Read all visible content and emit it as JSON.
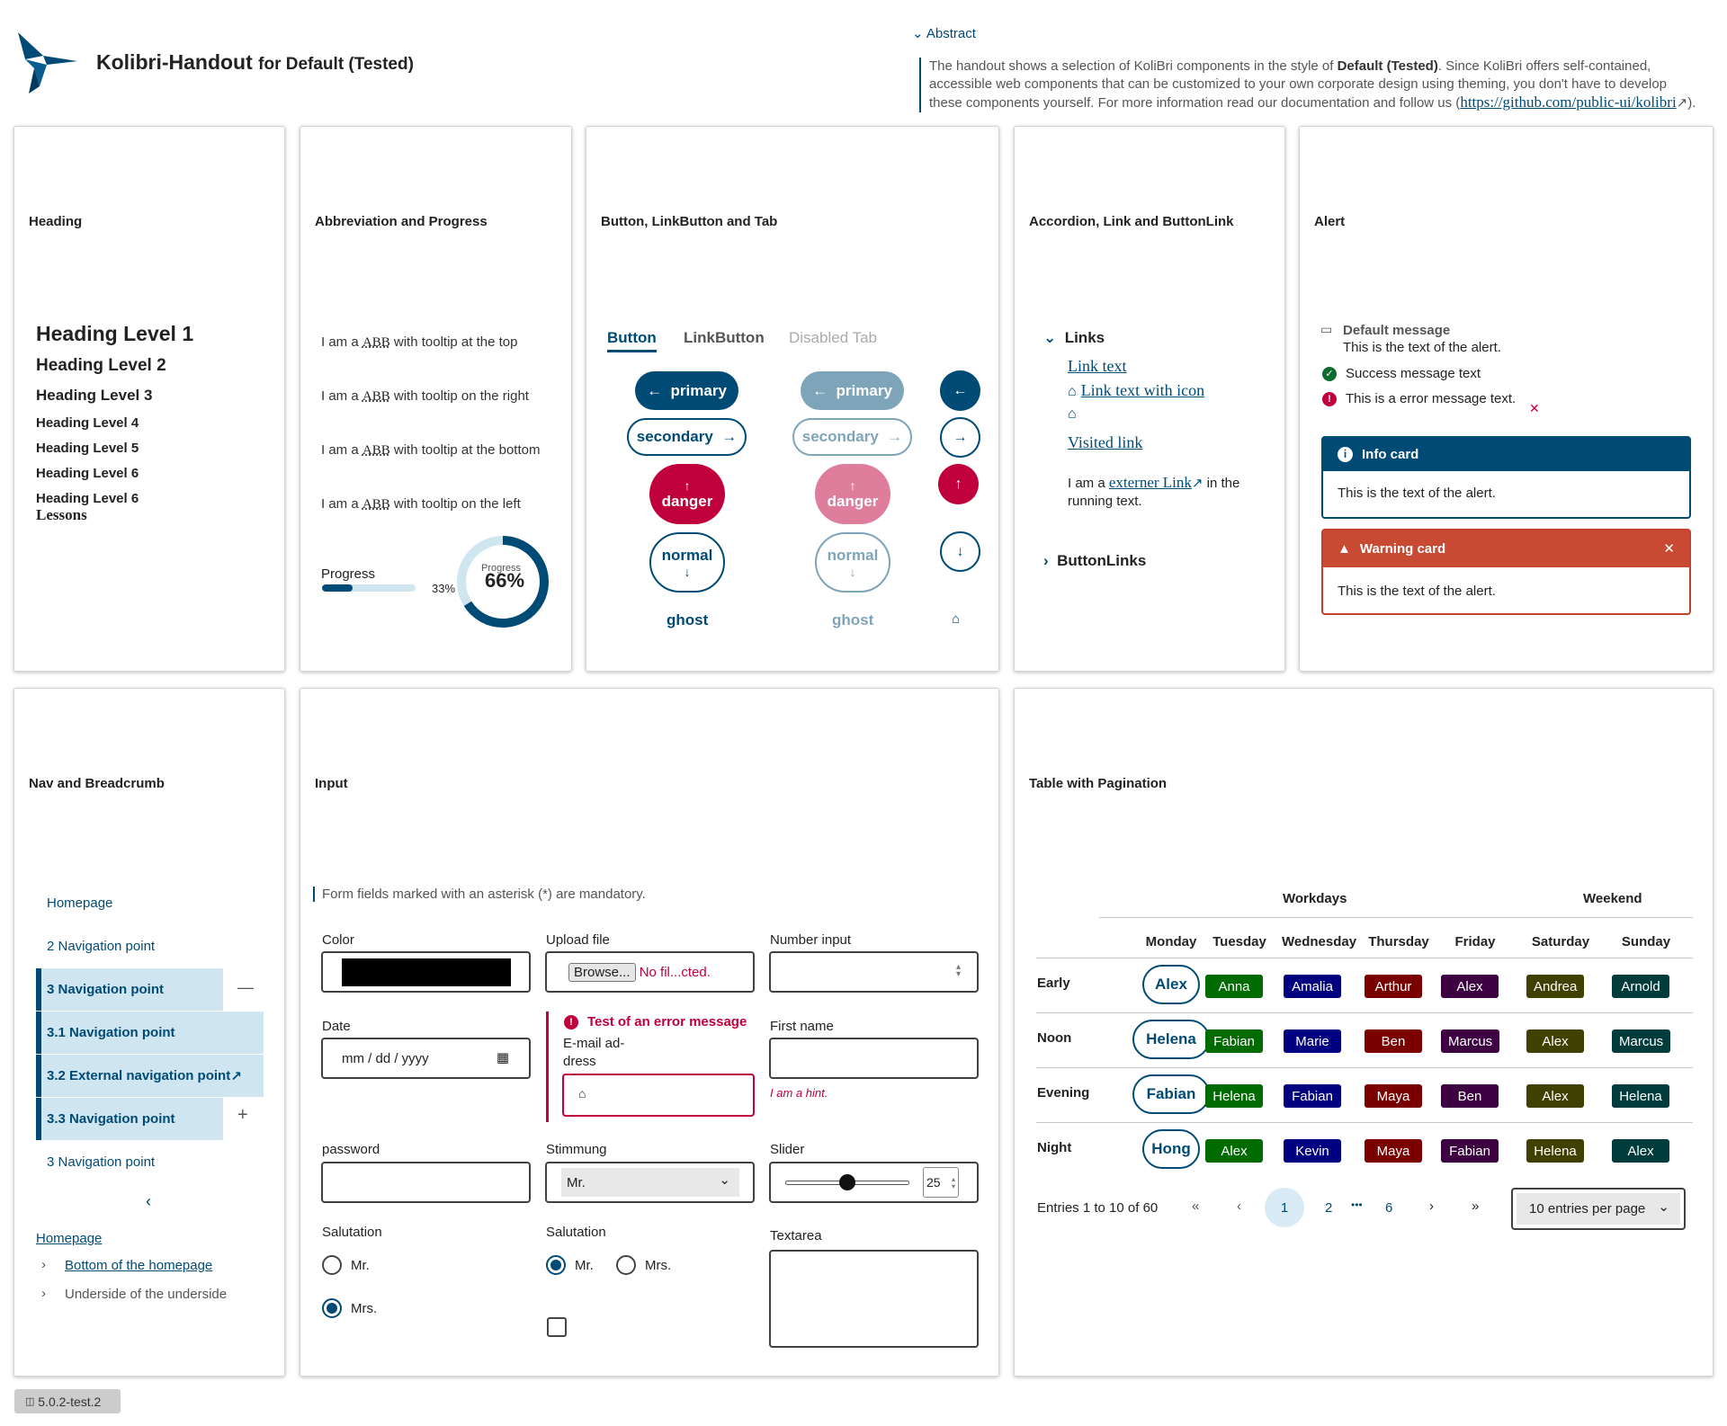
{
  "header": {
    "app_title": "Kolibri-Handout",
    "app_subtitle": "for Default (Tested)",
    "abstract_toggle": "Abstract",
    "abstract_pre": "The handout shows a selection of KoliBri components in the style of ",
    "abstract_bold": "Default (Tested)",
    "abstract_post": ". Since KoliBri offers self-contained, accessible web components that can be customized to your own corporate design using theming, you don't have to develop these components yourself. For more information read our documentation and follow us (",
    "abstract_link": "https://github.com/public-ui/kolibri",
    "abstract_end": ")."
  },
  "cards": {
    "heading": "Heading",
    "abbr": "Abbreviation and Progress",
    "button": "Button, LinkButton and Tab",
    "accordion": "Accordion, Link and ButtonLink",
    "alert": "Alert",
    "nav": "Nav and Breadcrumb",
    "input": "Input",
    "table": "Table with Pagination"
  },
  "headings": {
    "h1": "Heading Level 1",
    "h2": "Heading Level 2",
    "h3": "Heading Level 3",
    "h4": "Heading Level 4",
    "h5": "Heading Level 5",
    "h6a": "Heading Level 6",
    "h6b": "Heading Level 6",
    "sub": "Lessons"
  },
  "abbr": {
    "pre": "I am a ",
    "abbr": "ABB",
    "lines": [
      "with tooltip at the top",
      "with tooltip on the right",
      "with tooltip at the bottom",
      "with tooltip on the left"
    ],
    "progress_label": "Progress",
    "progress_value": "33%",
    "circle_label": "Progress",
    "circle_value": "66%",
    "bar_fraction": 0.33,
    "circle_fraction": 0.66
  },
  "tabs": {
    "t1": "Button",
    "t2": "LinkButton",
    "t3": "Disabled Tab"
  },
  "buttons": {
    "primary": "primary",
    "secondary": "secondary",
    "danger": "danger",
    "normal": "normal",
    "ghost": "ghost"
  },
  "accordion": {
    "links_title": "Links",
    "link1": "Link text",
    "link2": "Link text with icon",
    "visited": "Visited link",
    "running_pre": "I am a ",
    "running_link": "externer Link",
    "running_post": " in the running text.",
    "buttonlinks": "ButtonLinks"
  },
  "alert": {
    "default_title": "Default message",
    "default_text": "This is the text of the alert.",
    "success": "Success message text",
    "error": "This is a error message text.",
    "info_title": "Info card",
    "info_text": "This is the text of the alert.",
    "warn_title": "Warning card",
    "warn_text": "This is the text of the alert."
  },
  "nav": {
    "items": [
      "Homepage",
      "2 Navigation point",
      "3 Navigation point",
      "3.1 Navigation point",
      "3.2 External navigation point",
      "3.3 Navigation point",
      "3 Navigation point"
    ],
    "bc1": "Homepage",
    "bc2": "Bottom of the homepage",
    "bc3": "Underside of the underside"
  },
  "input": {
    "mandatory": "Form fields marked with an asterisk (*) are mandatory.",
    "color": "Color",
    "upload": "Upload file",
    "browse": "Browse...",
    "nofile": "No fil...cted.",
    "number": "Number input",
    "date": "Date",
    "date_ph": "mm / dd / yyyy",
    "error_msg": "Test of an error message",
    "email": "E-mail ad-\ndress",
    "first": "First name",
    "hint": "I am a hint.",
    "password": "password",
    "mood": "Stimmung",
    "mood_val": "Mr.",
    "slider": "Slider",
    "slider_val": "25",
    "salutation1": "Salutation",
    "salutation2": "Salutation",
    "mr": "Mr.",
    "mrs": "Mrs.",
    "textarea": "Textarea",
    "slider_fraction": 0.5
  },
  "table": {
    "workdays": "Workdays",
    "weekend": "Weekend",
    "days": [
      "Monday",
      "Tuesday",
      "Wednesday",
      "Thursday",
      "Friday",
      "Saturday",
      "Sunday"
    ],
    "rows": [
      {
        "label": "Early",
        "names": [
          "Alex",
          "Anna",
          "Amalia",
          "Arthur",
          "Alex",
          "Andrea",
          "Arnold"
        ]
      },
      {
        "label": "Noon",
        "names": [
          "Helena",
          "Fabian",
          "Marie",
          "Ben",
          "Marcus",
          "Alex",
          "Marcus"
        ]
      },
      {
        "label": "Evening",
        "names": [
          "Fabian",
          "Helena",
          "Fabian",
          "Maya",
          "Ben",
          "Alex",
          "Helena"
        ]
      },
      {
        "label": "Night",
        "names": [
          "Hong",
          "Alex",
          "Kevin",
          "Maya",
          "Fabian",
          "Helena",
          "Alex"
        ]
      }
    ],
    "day_colors": [
      "#ffffff",
      "#006b00",
      "#000080",
      "#7a0000",
      "#3d0040",
      "#404000",
      "#003c3c"
    ],
    "entries": "Entries 1 to 10 of 60",
    "pages": [
      "1",
      "2",
      "6"
    ],
    "ellipsis": "•••",
    "per_page": "10 entries per page"
  },
  "version": "5.0.2-test.2"
}
